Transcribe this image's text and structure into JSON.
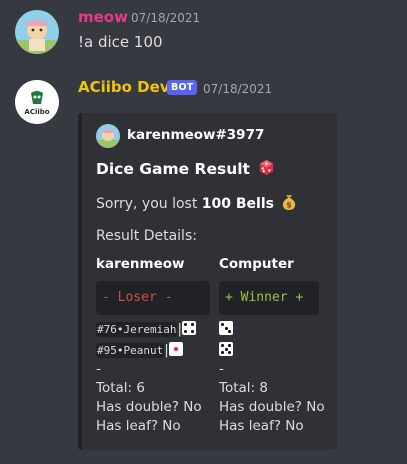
{
  "messages": [
    {
      "username": "meow",
      "username_color": "#e23b8a",
      "timestamp": "07/18/2021",
      "text": "!a dice 100"
    },
    {
      "username": "ACiibo Dev",
      "username_color": "#f1c40f",
      "badge": "BOT",
      "timestamp": "07/18/2021",
      "avatar_text": "ACiibo"
    }
  ],
  "embed": {
    "author": "karenmeow#3977",
    "title": "Dice Game Result",
    "title_icon": "game-die-icon",
    "description_prefix": "Sorry, you lost",
    "description_amount": "100 Bells",
    "description_icon": "money-bag-icon",
    "details_label": "Result Details:",
    "fields": [
      {
        "name": "karenmeow",
        "result": "- Loser -",
        "result_color": "#dd4a4a",
        "dice": [
          {
            "label": "#76•Jeremiah",
            "die_value": 4
          },
          {
            "label": "#95•Peanut",
            "die_value": 1
          }
        ],
        "dash": "-",
        "total": "Total: 6",
        "double": "Has double? No",
        "leaf": "Has leaf? No"
      },
      {
        "name": "Computer",
        "result": "+ Winner +",
        "result_color": "#99c24d",
        "dice": [
          {
            "label": "",
            "die_value": 3
          },
          {
            "label": "",
            "die_value": 5
          }
        ],
        "dash": "-",
        "total": "Total: 8",
        "double": "Has double? No",
        "leaf": "Has leaf? No"
      }
    ]
  }
}
